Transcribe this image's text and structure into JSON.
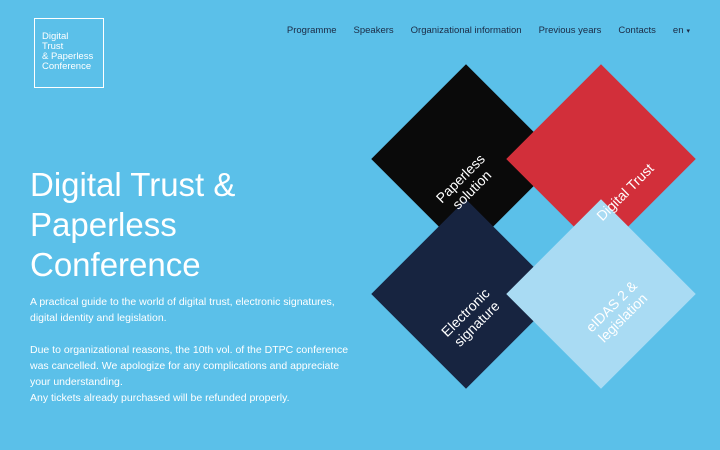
{
  "logo": {
    "line1": "Digital",
    "line2": "Trust",
    "line3": "& Paperless",
    "line4": "Conference"
  },
  "nav": {
    "items": [
      {
        "label": "Programme"
      },
      {
        "label": "Speakers"
      },
      {
        "label": "Organizational information"
      },
      {
        "label": "Previous years"
      },
      {
        "label": "Contacts"
      }
    ],
    "language": "en",
    "language_caret": "▾"
  },
  "hero": {
    "title_line1": "Digital Trust &",
    "title_line2": "Paperless",
    "title_line3": "Conference",
    "intro": "A practical guide to the world of digital trust, electronic signatures, digital identity and legislation.",
    "notice_line1": "Due to organizational reasons, the 10th vol. of the DTPC conference was cancelled. We apologize for any complications and appreciate your understanding.",
    "notice_line2": "Any tickets already purchased will be refunded properly."
  },
  "tiles": [
    {
      "line1": "Paperless",
      "line2": "solution",
      "color": "#0a0a0a"
    },
    {
      "line1": "Digital Trust",
      "line2": "",
      "color": "#d22f3a"
    },
    {
      "line1": "Electronic",
      "line2": "signature",
      "color": "#172440"
    },
    {
      "line1": "eIDAS 2 &",
      "line2": "legislation",
      "color": "#a9dbf3"
    }
  ],
  "colors": {
    "background": "#5bc0e9",
    "nav_text": "#1b2a44",
    "text": "#ffffff"
  }
}
